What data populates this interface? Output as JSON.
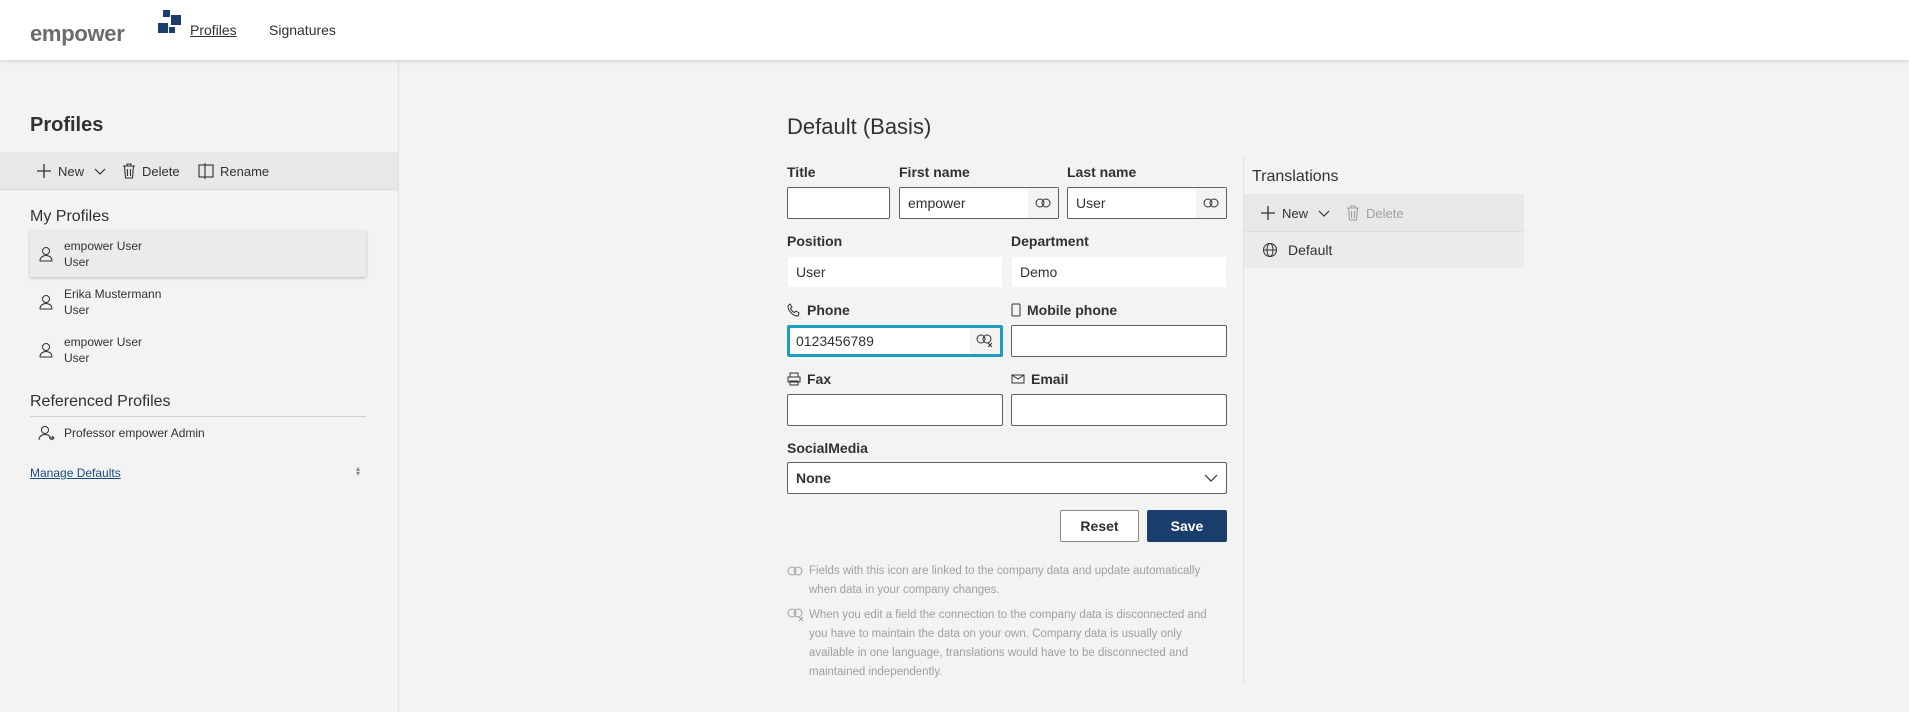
{
  "brand": {
    "name": "empower",
    "accent": "#1a3e6b"
  },
  "nav": [
    {
      "label": "Profiles",
      "active": true
    },
    {
      "label": "Signatures",
      "active": false
    }
  ],
  "sidebar": {
    "title": "Profiles",
    "toolbar": {
      "new_label": "New",
      "delete_label": "Delete",
      "rename_label": "Rename"
    },
    "my_profiles_title": "My Profiles",
    "my_profiles": [
      {
        "name": "empower User",
        "role": "User",
        "selected": true
      },
      {
        "name": "Erika Mustermann",
        "role": "User",
        "selected": false
      },
      {
        "name": "empower User",
        "role": "User",
        "selected": false
      }
    ],
    "referenced_title": "Referenced Profiles",
    "referenced": [
      {
        "name": "Professor empower Admin"
      }
    ],
    "manage_defaults": "Manage Defaults"
  },
  "form": {
    "title": "Default (Basis)",
    "title_label": "Title",
    "title_value": "",
    "first_name_label": "First name",
    "first_name_value": "empower",
    "last_name_label": "Last name",
    "last_name_value": "User",
    "position_label": "Position",
    "position_value": "User",
    "department_label": "Department",
    "department_value": "Demo",
    "phone_label": "Phone",
    "phone_value": "0123456789",
    "mobile_label": "Mobile phone",
    "mobile_value": "",
    "fax_label": "Fax",
    "fax_value": "",
    "email_label": "Email",
    "email_value": "",
    "social_label": "SocialMedia",
    "social_value": "None",
    "reset_label": "Reset",
    "save_label": "Save",
    "hint_linked": "Fields with this icon are linked to the company data and update automatically when data in your company changes.",
    "hint_unlinked": "When you edit a field the connection to the company data is disconnected and you have to maintain the data on your own. Company data is usually only available in one language, translations would have to be disconnected and maintained independently."
  },
  "translations": {
    "title": "Translations",
    "new_label": "New",
    "delete_label": "Delete",
    "items": [
      {
        "label": "Default"
      }
    ]
  },
  "colors": {
    "focus": "#1e9dbf",
    "link": "#1a4b7a"
  }
}
